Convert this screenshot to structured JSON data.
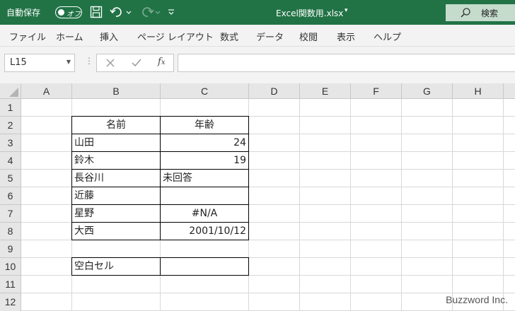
{
  "titlebar": {
    "autosave_label": "自動保存",
    "autosave_state": "オフ",
    "document_title": "Excel関数用.xlsx",
    "search_label": "検索",
    "bg_color": "#217346"
  },
  "menu": {
    "items": [
      "ファイル",
      "ホーム",
      "挿入",
      "ページ レイアウト",
      "数式",
      "データ",
      "校閲",
      "表示",
      "ヘルプ"
    ]
  },
  "formula_bar": {
    "name_box": "L15",
    "formula": ""
  },
  "columns": [
    "A",
    "B",
    "C",
    "D",
    "E",
    "F",
    "G",
    "H"
  ],
  "rows": [
    "1",
    "2",
    "3",
    "4",
    "5",
    "6",
    "7",
    "8",
    "9",
    "10",
    "11",
    "12"
  ],
  "table": {
    "header": {
      "name": "名前",
      "age": "年齢"
    },
    "rows": [
      {
        "name": "山田",
        "age": "24"
      },
      {
        "name": "鈴木",
        "age": "19"
      },
      {
        "name": "長谷川",
        "age": "未回答"
      },
      {
        "name": "近藤",
        "age": ""
      },
      {
        "name": "星野",
        "age": "#N/A"
      },
      {
        "name": "大西",
        "age": "2001/10/12"
      }
    ],
    "blank_cell_label": "空白セル",
    "blank_cell_value": ""
  },
  "watermark": "Buzzword Inc."
}
